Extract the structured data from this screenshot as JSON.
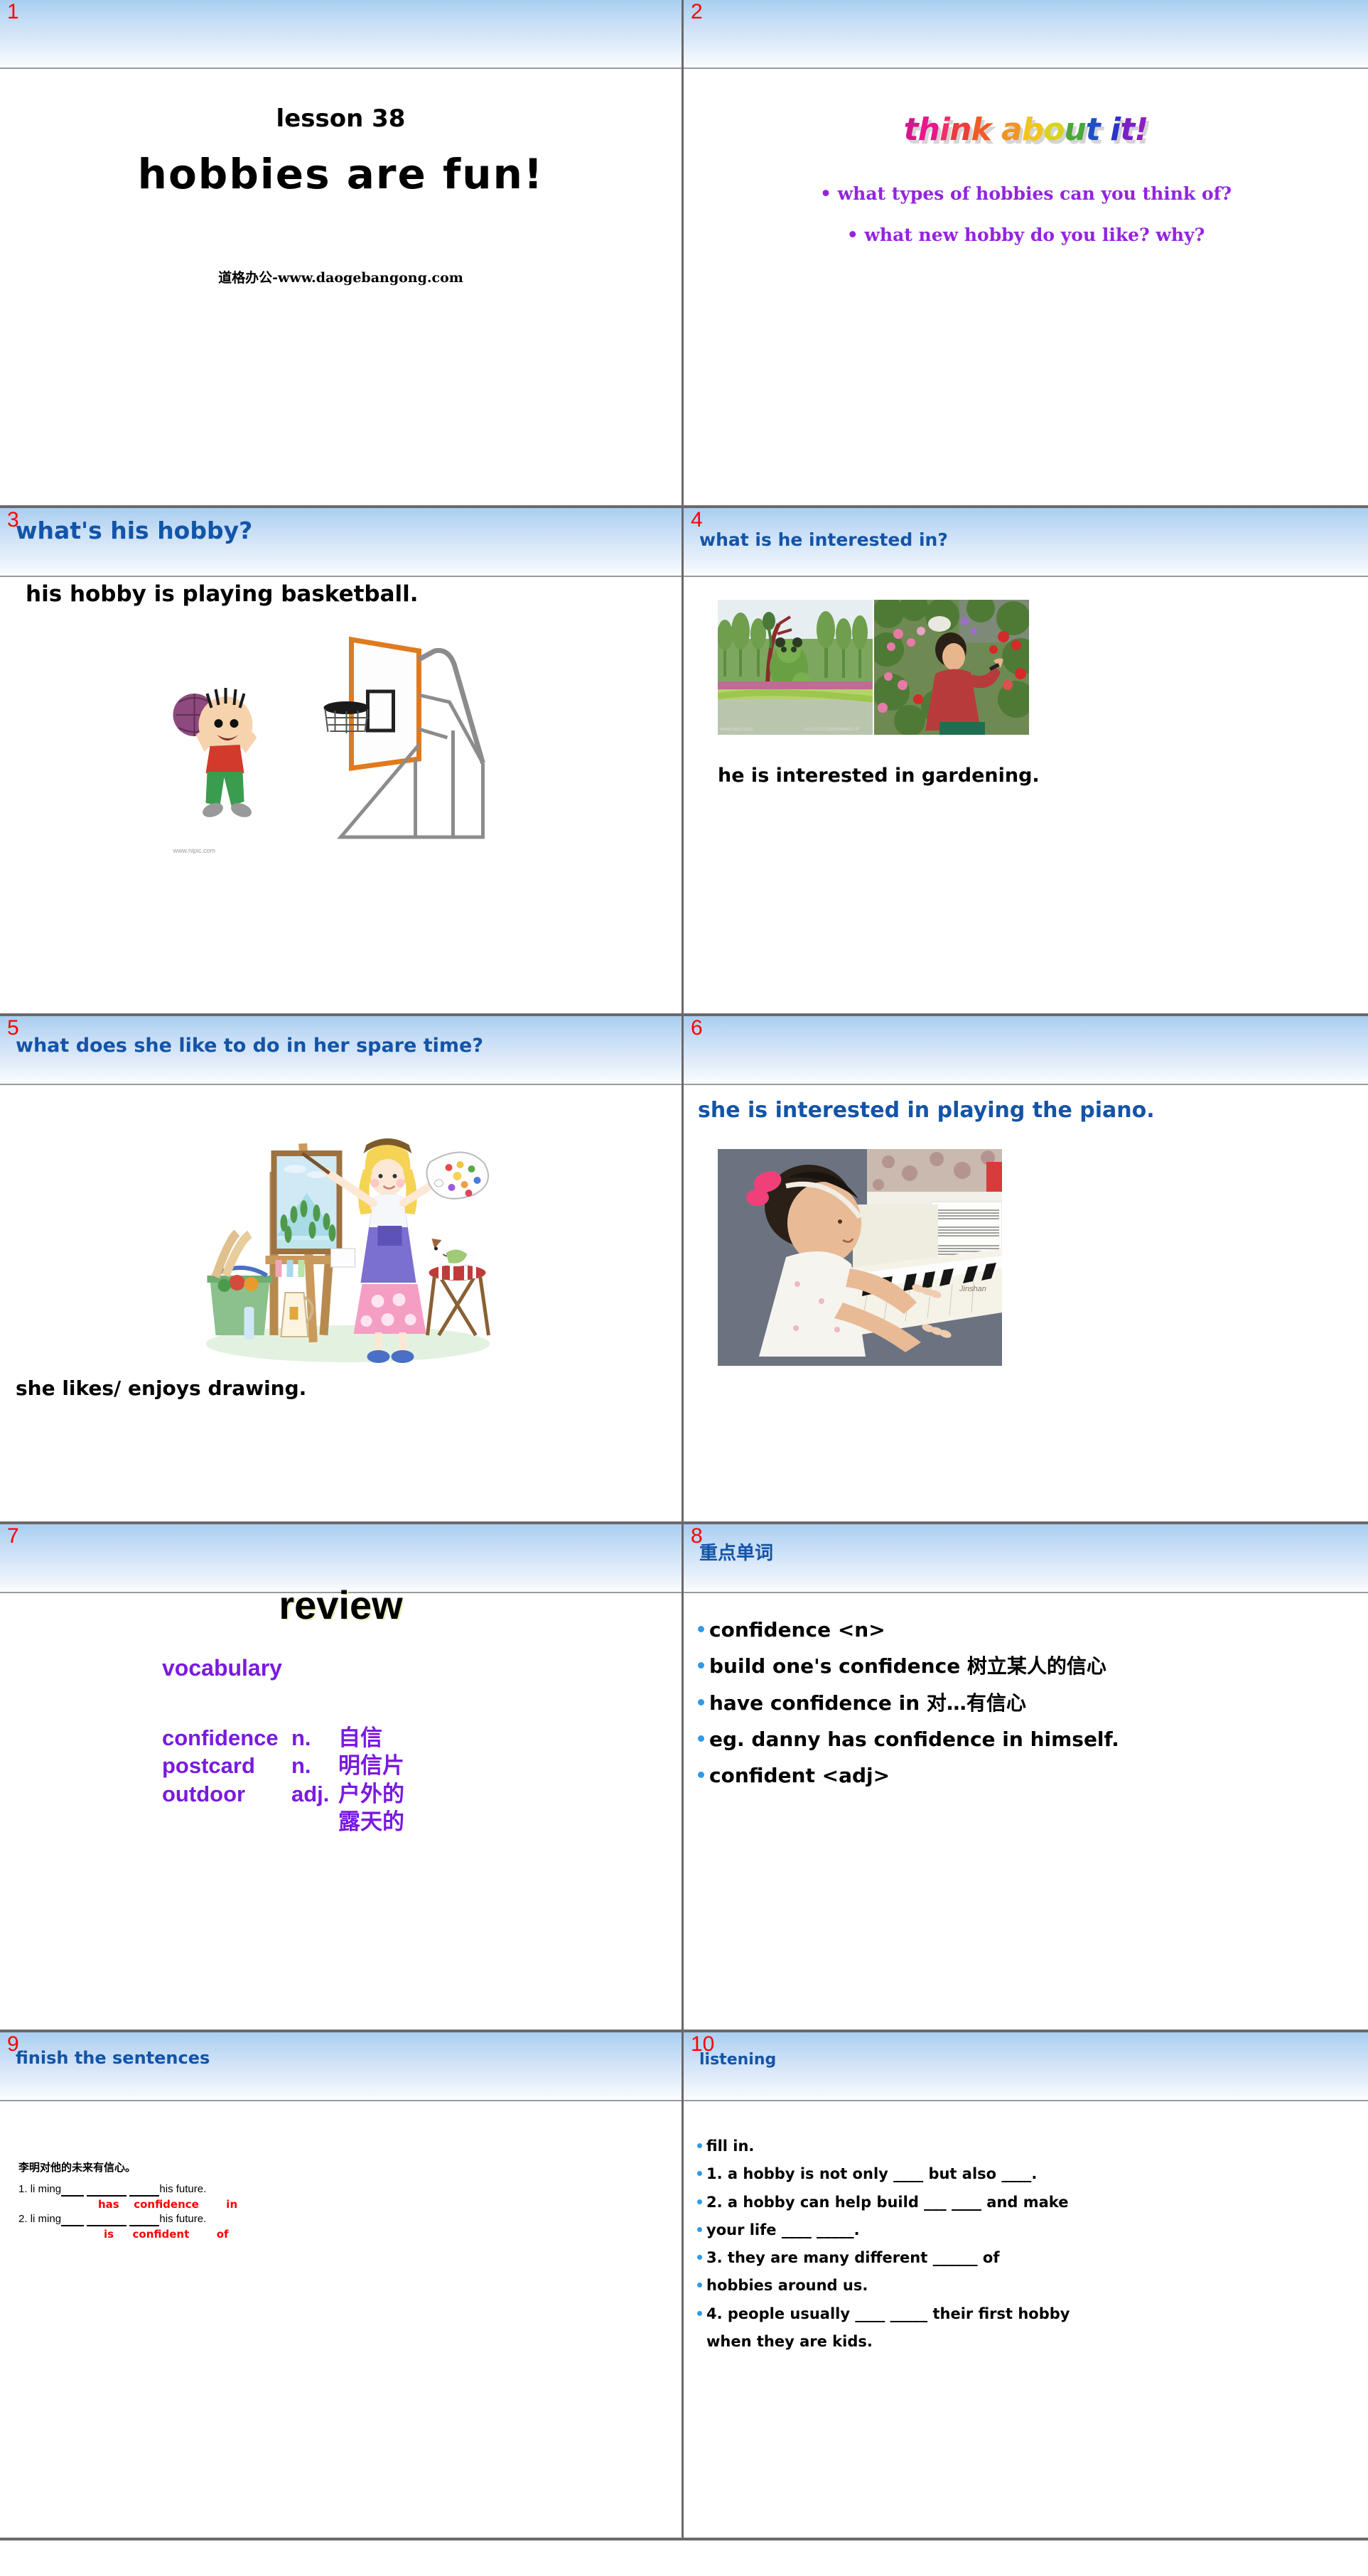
{
  "deck": {
    "accent_blue": "#1354a8",
    "accent_purple": "#7a1ae0",
    "accent_red": "#ff0000",
    "bullet_blue": "#2f9ae8"
  },
  "slides": [
    {
      "number": "1",
      "header_title": "",
      "lesson": "lesson 38",
      "title": "hobbies are fun!",
      "site": "道格办公-www.daogebangong.com"
    },
    {
      "number": "2",
      "header_title": "",
      "wordart": "think about it!",
      "bullets": [
        "• what types of hobbies can you think of?",
        "• what new hobby do you like? why?"
      ]
    },
    {
      "number": "3",
      "header_title": "what's his hobby?",
      "caption": "his hobby is playing basketball.",
      "image_alt": "boy-playing-basketball-cartoon",
      "watermark": "www.nipic.com"
    },
    {
      "number": "4",
      "header_title": "what is he interested in?",
      "caption": "he is interested in gardening.",
      "image_alt_left": "topiary-garden-photo",
      "image_alt_right": "man-pruning-flowers-photo"
    },
    {
      "number": "5",
      "header_title": "what does she like to do in her spare time?",
      "caption": "she likes/ enjoys drawing.",
      "image_alt": "girl-painting-at-easel-cartoon"
    },
    {
      "number": "6",
      "header_title": "",
      "caption": "she is interested in playing the piano.",
      "image_alt": "girl-playing-piano-photo"
    },
    {
      "number": "7",
      "header_title": "",
      "review_title": "review",
      "section": "vocabulary",
      "words": [
        {
          "word": "confidence",
          "pos": "n.",
          "meaning": "自信"
        },
        {
          "word": "postcard",
          "pos": "n.",
          "meaning": "明信片"
        },
        {
          "word": "outdoor",
          "pos": "adj.",
          "meaning": "户外的"
        }
      ],
      "extra_meaning": "露天的"
    },
    {
      "number": "8",
      "header_title": "重点单词",
      "items": [
        "confidence  <n>",
        "build one's confidence 树立某人的信心",
        "have confidence in    对…有信心",
        "eg. danny has confidence in himself.",
        "confident  <adj>"
      ]
    },
    {
      "number": "9",
      "header_title": "finish the sentences",
      "chinese_prompt": "李明对他的未来有信心。",
      "questions": [
        {
          "num": "1.",
          "lead": "li ming",
          "tail": "his future."
        },
        {
          "num": "2.",
          "lead": "li ming",
          "tail": "his future."
        }
      ],
      "answers_row1": [
        "has",
        "confidence",
        "in"
      ],
      "answers_row2": [
        "is",
        "confident",
        "of"
      ]
    },
    {
      "number": "10",
      "header_title": "listening",
      "items": [
        "fill in.",
        "1. a hobby is not only ____  but also ____.",
        "2. a hobby can help build  ___   ____ and make",
        "your life ____ _____.",
        "3. they are many different ______ of",
        "hobbies around us.",
        "4.  people usually ____ _____ their first hobby",
        "when they are kids."
      ]
    }
  ]
}
